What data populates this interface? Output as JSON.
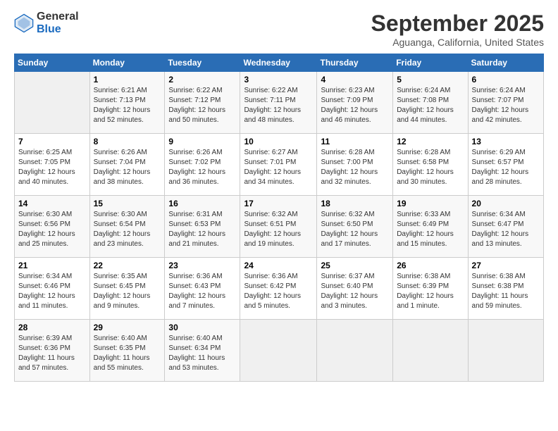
{
  "header": {
    "logo_line1": "General",
    "logo_line2": "Blue",
    "title": "September 2025",
    "subtitle": "Aguanga, California, United States"
  },
  "columns": [
    "Sunday",
    "Monday",
    "Tuesday",
    "Wednesday",
    "Thursday",
    "Friday",
    "Saturday"
  ],
  "weeks": [
    [
      {
        "day": "",
        "info": ""
      },
      {
        "day": "1",
        "info": "Sunrise: 6:21 AM\nSunset: 7:13 PM\nDaylight: 12 hours\nand 52 minutes."
      },
      {
        "day": "2",
        "info": "Sunrise: 6:22 AM\nSunset: 7:12 PM\nDaylight: 12 hours\nand 50 minutes."
      },
      {
        "day": "3",
        "info": "Sunrise: 6:22 AM\nSunset: 7:11 PM\nDaylight: 12 hours\nand 48 minutes."
      },
      {
        "day": "4",
        "info": "Sunrise: 6:23 AM\nSunset: 7:09 PM\nDaylight: 12 hours\nand 46 minutes."
      },
      {
        "day": "5",
        "info": "Sunrise: 6:24 AM\nSunset: 7:08 PM\nDaylight: 12 hours\nand 44 minutes."
      },
      {
        "day": "6",
        "info": "Sunrise: 6:24 AM\nSunset: 7:07 PM\nDaylight: 12 hours\nand 42 minutes."
      }
    ],
    [
      {
        "day": "7",
        "info": "Sunrise: 6:25 AM\nSunset: 7:05 PM\nDaylight: 12 hours\nand 40 minutes."
      },
      {
        "day": "8",
        "info": "Sunrise: 6:26 AM\nSunset: 7:04 PM\nDaylight: 12 hours\nand 38 minutes."
      },
      {
        "day": "9",
        "info": "Sunrise: 6:26 AM\nSunset: 7:02 PM\nDaylight: 12 hours\nand 36 minutes."
      },
      {
        "day": "10",
        "info": "Sunrise: 6:27 AM\nSunset: 7:01 PM\nDaylight: 12 hours\nand 34 minutes."
      },
      {
        "day": "11",
        "info": "Sunrise: 6:28 AM\nSunset: 7:00 PM\nDaylight: 12 hours\nand 32 minutes."
      },
      {
        "day": "12",
        "info": "Sunrise: 6:28 AM\nSunset: 6:58 PM\nDaylight: 12 hours\nand 30 minutes."
      },
      {
        "day": "13",
        "info": "Sunrise: 6:29 AM\nSunset: 6:57 PM\nDaylight: 12 hours\nand 28 minutes."
      }
    ],
    [
      {
        "day": "14",
        "info": "Sunrise: 6:30 AM\nSunset: 6:56 PM\nDaylight: 12 hours\nand 25 minutes."
      },
      {
        "day": "15",
        "info": "Sunrise: 6:30 AM\nSunset: 6:54 PM\nDaylight: 12 hours\nand 23 minutes."
      },
      {
        "day": "16",
        "info": "Sunrise: 6:31 AM\nSunset: 6:53 PM\nDaylight: 12 hours\nand 21 minutes."
      },
      {
        "day": "17",
        "info": "Sunrise: 6:32 AM\nSunset: 6:51 PM\nDaylight: 12 hours\nand 19 minutes."
      },
      {
        "day": "18",
        "info": "Sunrise: 6:32 AM\nSunset: 6:50 PM\nDaylight: 12 hours\nand 17 minutes."
      },
      {
        "day": "19",
        "info": "Sunrise: 6:33 AM\nSunset: 6:49 PM\nDaylight: 12 hours\nand 15 minutes."
      },
      {
        "day": "20",
        "info": "Sunrise: 6:34 AM\nSunset: 6:47 PM\nDaylight: 12 hours\nand 13 minutes."
      }
    ],
    [
      {
        "day": "21",
        "info": "Sunrise: 6:34 AM\nSunset: 6:46 PM\nDaylight: 12 hours\nand 11 minutes."
      },
      {
        "day": "22",
        "info": "Sunrise: 6:35 AM\nSunset: 6:45 PM\nDaylight: 12 hours\nand 9 minutes."
      },
      {
        "day": "23",
        "info": "Sunrise: 6:36 AM\nSunset: 6:43 PM\nDaylight: 12 hours\nand 7 minutes."
      },
      {
        "day": "24",
        "info": "Sunrise: 6:36 AM\nSunset: 6:42 PM\nDaylight: 12 hours\nand 5 minutes."
      },
      {
        "day": "25",
        "info": "Sunrise: 6:37 AM\nSunset: 6:40 PM\nDaylight: 12 hours\nand 3 minutes."
      },
      {
        "day": "26",
        "info": "Sunrise: 6:38 AM\nSunset: 6:39 PM\nDaylight: 12 hours\nand 1 minute."
      },
      {
        "day": "27",
        "info": "Sunrise: 6:38 AM\nSunset: 6:38 PM\nDaylight: 11 hours\nand 59 minutes."
      }
    ],
    [
      {
        "day": "28",
        "info": "Sunrise: 6:39 AM\nSunset: 6:36 PM\nDaylight: 11 hours\nand 57 minutes."
      },
      {
        "day": "29",
        "info": "Sunrise: 6:40 AM\nSunset: 6:35 PM\nDaylight: 11 hours\nand 55 minutes."
      },
      {
        "day": "30",
        "info": "Sunrise: 6:40 AM\nSunset: 6:34 PM\nDaylight: 11 hours\nand 53 minutes."
      },
      {
        "day": "",
        "info": ""
      },
      {
        "day": "",
        "info": ""
      },
      {
        "day": "",
        "info": ""
      },
      {
        "day": "",
        "info": ""
      }
    ]
  ]
}
